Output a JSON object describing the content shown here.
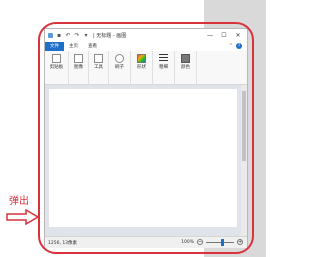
{
  "window": {
    "title": "| 无标题 - 画图",
    "controls": {
      "minimize": "—",
      "maximize": "☐",
      "close": "✕"
    }
  },
  "ribbon": {
    "tabs": [
      {
        "label": "文件"
      },
      {
        "label": "主页"
      },
      {
        "label": "查看"
      }
    ],
    "groups": [
      {
        "label": "剪贴板"
      },
      {
        "label": "图像"
      },
      {
        "label": "工具"
      },
      {
        "label": "刷子"
      },
      {
        "label": "形状"
      },
      {
        "label": "粗细"
      },
      {
        "label": "颜色"
      }
    ]
  },
  "statusbar": {
    "canvas_size": "1256, 13像素",
    "zoom_level": "100%",
    "zoom_fraction": 0.55,
    "zoom_out": "−",
    "zoom_in": "+"
  },
  "annotation": {
    "label": "弹出",
    "color": "#d8323c"
  }
}
